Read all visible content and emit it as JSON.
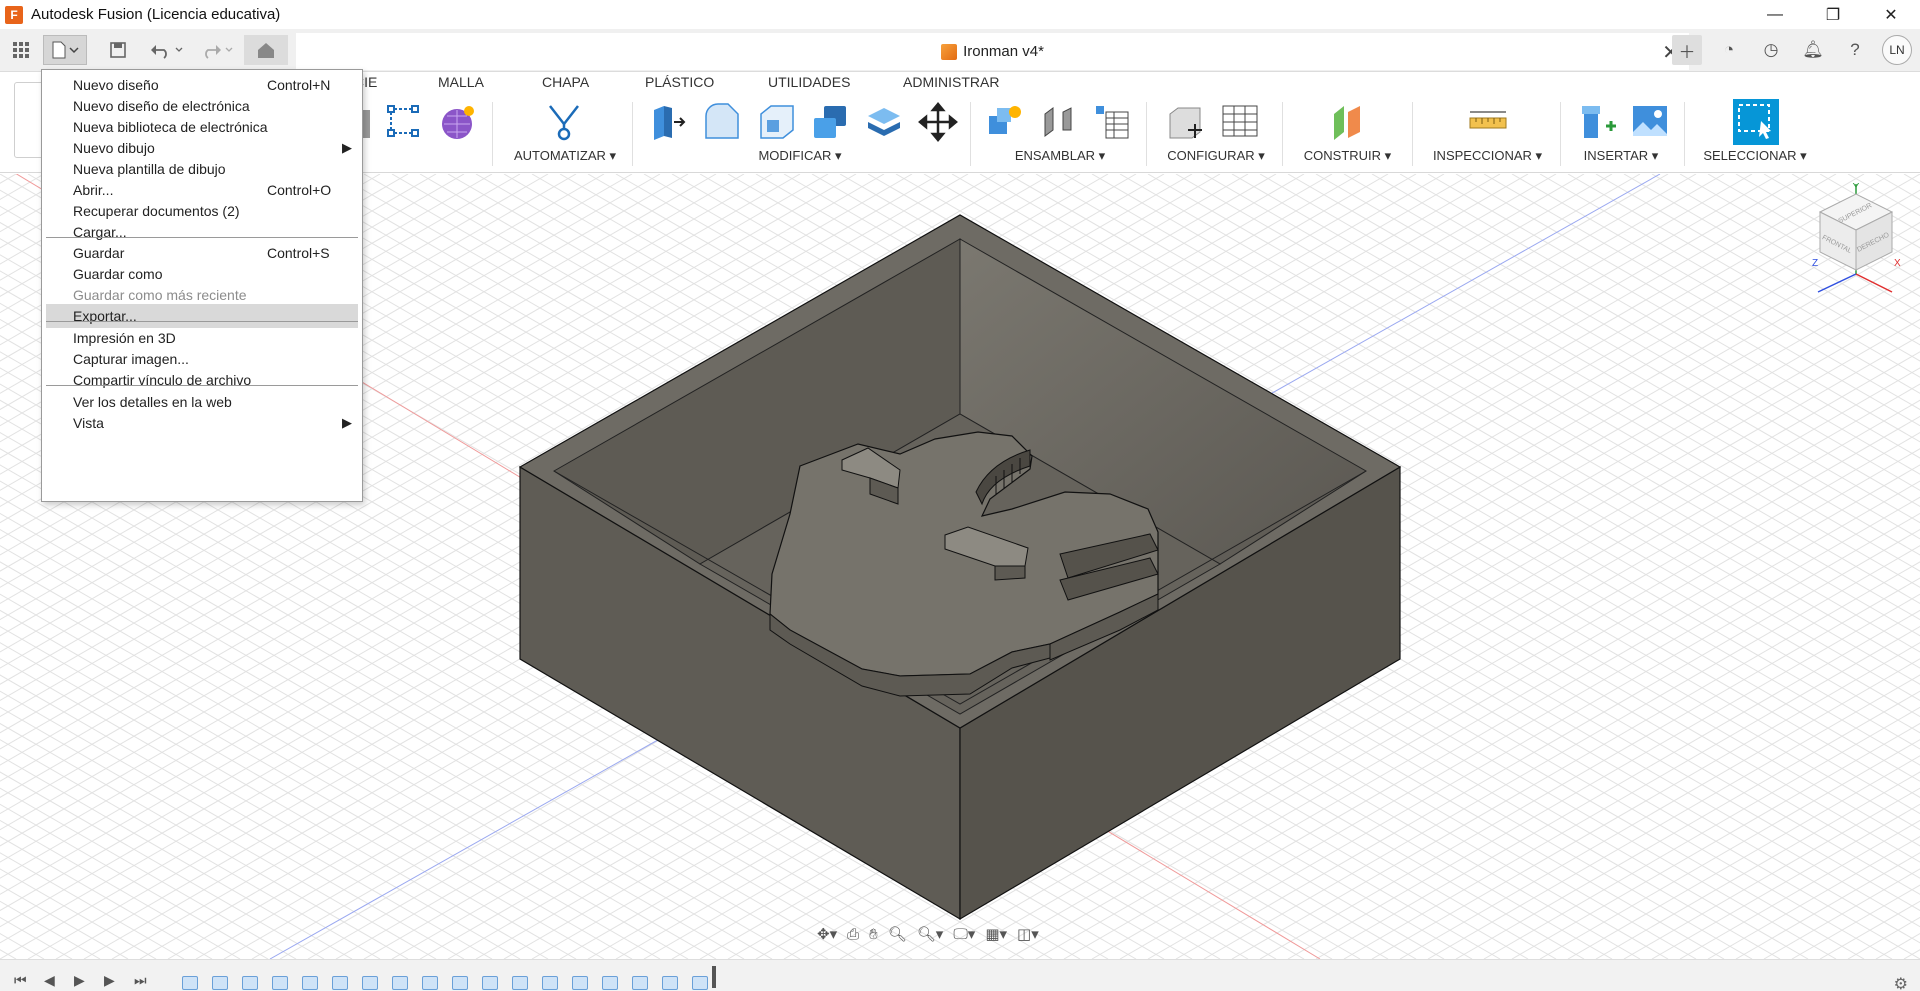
{
  "window": {
    "title": "Autodesk Fusion (Licencia educativa)",
    "logo_letter": "F",
    "controls": {
      "minimize": "—",
      "restore": "❐",
      "close": "✕"
    }
  },
  "doc_tab": {
    "title": "Ironman v4*",
    "close": "✕"
  },
  "user": {
    "initials": "LN"
  },
  "ribbon": {
    "tabs": [
      "CIE",
      "MALLA",
      "CHAPA",
      "PLÁSTICO",
      "UTILIDADES",
      "ADMINISTRAR"
    ],
    "groups": [
      "AUTOMATIZAR ▾",
      "MODIFICAR ▾",
      "ENSAMBLAR ▾",
      "CONFIGURAR ▾",
      "CONSTRUIR ▾",
      "INSPECCIONAR ▾",
      "INSERTAR ▾",
      "SELECCIONAR ▾"
    ]
  },
  "file_menu": {
    "items": [
      {
        "label": "Nuevo diseño",
        "shortcut": "Control+N"
      },
      {
        "label": "Nuevo diseño de electrónica"
      },
      {
        "label": "Nueva biblioteca de electrónica"
      },
      {
        "label": "Nuevo dibujo",
        "submenu": true
      },
      {
        "label": "Nueva plantilla de dibujo"
      },
      {
        "label": "Abrir...",
        "shortcut": "Control+O"
      },
      {
        "label": "Recuperar documentos (2)"
      },
      {
        "label": "Cargar..."
      },
      {
        "label": "Guardar",
        "shortcut": "Control+S"
      },
      {
        "label": "Guardar como"
      },
      {
        "label": "Guardar como más reciente",
        "disabled": true
      },
      {
        "label": "Exportar...",
        "highlighted": true
      },
      {
        "label": "Impresión en 3D"
      },
      {
        "label": "Capturar imagen..."
      },
      {
        "label": "Compartir vínculo de archivo"
      },
      {
        "label": "Ver los detalles en la web"
      },
      {
        "label": "Vista",
        "submenu": true
      }
    ],
    "arrow": "▶"
  },
  "viewcube": {
    "top": "SUPERIOR",
    "front": "FRONTAL",
    "right": "DERECHO",
    "axis_x": "X",
    "axis_y": "Y",
    "axis_z": "Z"
  },
  "colors": {
    "body_dark": "#4a4741",
    "body_mid": "#6b6760",
    "body_light": "#85827a",
    "selection_blue": "#0696d7",
    "accent_orange": "#e8641a"
  }
}
